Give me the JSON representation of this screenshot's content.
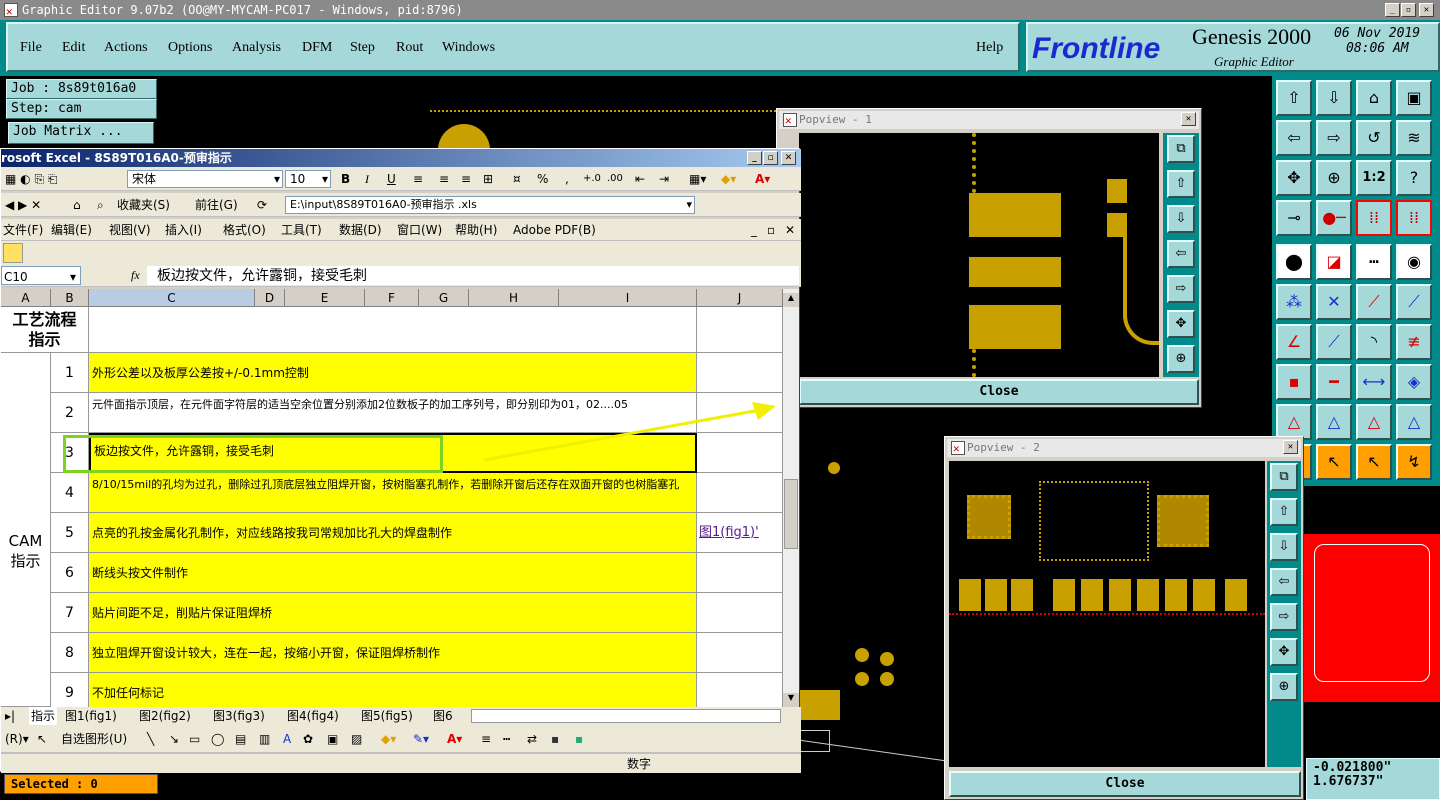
{
  "genesis": {
    "title": "Graphic Editor 9.07b2 (OO@MY-MYCAM-PC017 - Windows, pid:8796)",
    "menu": [
      "File",
      "Edit",
      "Actions",
      "Options",
      "Analysis",
      "DFM",
      "Step",
      "Rout",
      "Windows"
    ],
    "help": "Help",
    "brand_logo": "Frontline",
    "brand_product": "Genesis 2000",
    "brand_sub": "Graphic Editor",
    "date": "06 Nov 2019",
    "time": "08:06 AM",
    "job": "Job : 8s89t016a0",
    "step": "Step: cam",
    "job_matrix": "Job Matrix ...",
    "selected": "Selected : 0",
    "coord_x": "-0.021800\"",
    "coord_y": "1.676737\""
  },
  "popview1": {
    "title": "Popview - 1",
    "close": "Close"
  },
  "popview2": {
    "title": "Popview - 2",
    "close": "Close"
  },
  "excel": {
    "title": "rosoft Excel - 8S89T016A0-预审指示",
    "font": "宋体",
    "size": "10",
    "favorites": "收藏夹(S)",
    "goto": "前往(G)",
    "path": "E:\\input\\8S89T016A0-预审指示 .xls",
    "menu": [
      "文件(F)",
      "编辑(E)",
      "视图(V)",
      "插入(I)",
      "格式(O)",
      "工具(T)",
      "数据(D)",
      "窗口(W)",
      "帮助(H)",
      "Adobe PDF(B)"
    ],
    "namebox": "C10",
    "fx": "fx",
    "formula": "板边按文件，允许露铜，接受毛刺",
    "columns": [
      "A",
      "B",
      "C",
      "D",
      "E",
      "F",
      "G",
      "H",
      "I",
      "J"
    ],
    "section1": "工艺流程指示",
    "section2": "CAM指示",
    "rows": [
      {
        "n": "1",
        "text": "外形公差以及板厚公差按+/-0.1mm控制"
      },
      {
        "n": "2",
        "text": "元件面指示顶层，在元件面字符层的适当空余位置分别添加2位数板子的加工序列号，即分别印为01，02....05"
      },
      {
        "n": "3",
        "text": "板边按文件，允许露铜，接受毛刺"
      },
      {
        "n": "4",
        "text": "8/10/15mil的孔均为过孔，删除过孔顶底层独立阻焊开窗，按树脂塞孔制作，若删除开窗后还存在双面开窗的也树脂塞孔"
      },
      {
        "n": "5",
        "text": "点亮的孔按金属化孔制作，对应线路按我司常规加比孔大的焊盘制作"
      },
      {
        "n": "6",
        "text": "断线头按文件制作"
      },
      {
        "n": "7",
        "text": "贴片间距不足，削贴片保证阻焊桥"
      },
      {
        "n": "8",
        "text": "独立阻焊开窗设计较大，连在一起，按缩小开窗，保证阻焊桥制作"
      },
      {
        "n": "9",
        "text": "不加任何标记"
      }
    ],
    "link": "图1(fig1)'",
    "sheets": [
      "指示",
      "图1(fig1)",
      "图2(fig2)",
      "图3(fig3)",
      "图4(fig4)",
      "图5(fig5)",
      "图6"
    ],
    "drawing": "自选图形(U)",
    "status": "数字"
  },
  "colors": {
    "accent": "#a5d8d8",
    "teal": "#008a8a",
    "copper": "#c8a000",
    "highlight": "#ffff00"
  }
}
